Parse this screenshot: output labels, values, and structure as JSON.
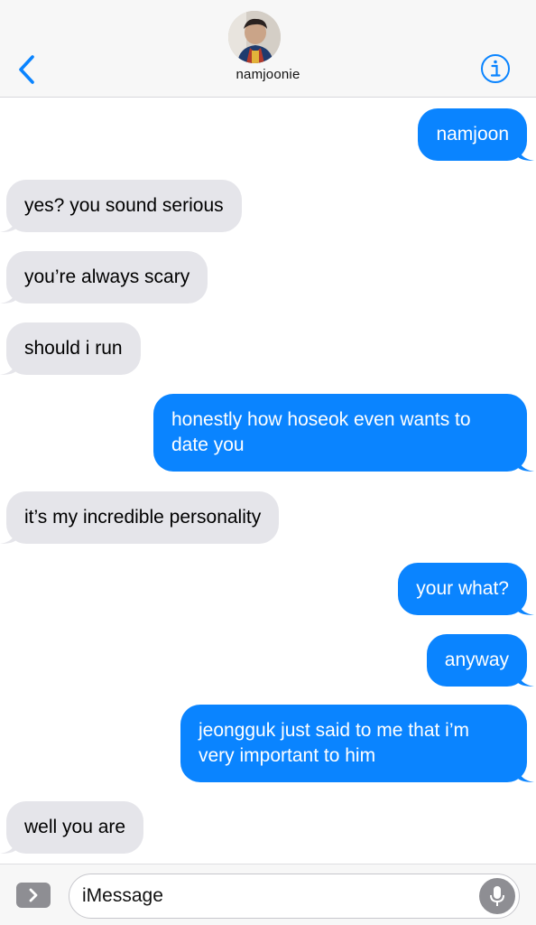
{
  "header": {
    "contact_name": "namjoonie",
    "back_icon": "chevron-left-icon",
    "info_icon": "info-icon",
    "accent_color": "#0a84ff"
  },
  "messages": [
    {
      "direction": "sent",
      "text": "namjoon"
    },
    {
      "direction": "received",
      "text": "yes? you sound serious"
    },
    {
      "direction": "received",
      "text": "you’re always scary"
    },
    {
      "direction": "received",
      "text": "should i run"
    },
    {
      "direction": "sent",
      "text": "honestly how hoseok even wants to date you"
    },
    {
      "direction": "received",
      "text": "it’s my incredible personality"
    },
    {
      "direction": "sent",
      "text": "your what?"
    },
    {
      "direction": "sent",
      "text": "anyway"
    },
    {
      "direction": "sent",
      "text": "jeongguk just said to me that i’m very important to him"
    },
    {
      "direction": "received",
      "text": "well you are"
    }
  ],
  "composer": {
    "placeholder": "iMessage",
    "apps_icon": "chevron-right-icon",
    "mic_icon": "microphone-icon"
  },
  "colors": {
    "sent_bubble": "#0a84ff",
    "received_bubble": "#e5e5ea"
  }
}
